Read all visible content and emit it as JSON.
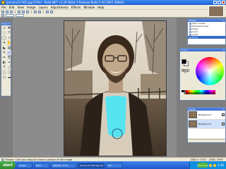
{
  "window": {
    "title": "January13 062.jpg (51%) - Paint.NET v3.20 (Beta 3 Release Build 3.20.2907.36844)"
  },
  "menu": [
    "File",
    "Edit",
    "View",
    "Image",
    "Layers",
    "Adjustments",
    "Effects",
    "Window",
    "Help"
  ],
  "tools_panel": {
    "title": "Tools"
  },
  "history_panel": {
    "title": "History",
    "items": [
      "Open Image",
      "Duplicate Layer",
      "Sepia",
      "Level",
      "Level",
      "Level"
    ]
  },
  "colors_panel": {
    "title": "Colors",
    "mode_label": "More >>"
  },
  "layers_panel": {
    "title": "Layers",
    "layers": [
      {
        "name": "Background",
        "visible": true
      },
      {
        "name": "Background",
        "visible": true
      }
    ]
  },
  "status": {
    "text": "Eraser: Click and drag to erase a portion of the image",
    "size": "1280 × 1707",
    "pos": "2080, 2997"
  },
  "taskbar": {
    "start_label": "start",
    "tasks": [
      "Image",
      "Paint",
      "Website cards",
      "January13 062.jpg (51...",
      "Doc"
    ],
    "tray_label": "Monument",
    "clock": "3:46"
  },
  "colors": {
    "accent": "#316ac5",
    "highlight": "#56e4f0"
  }
}
